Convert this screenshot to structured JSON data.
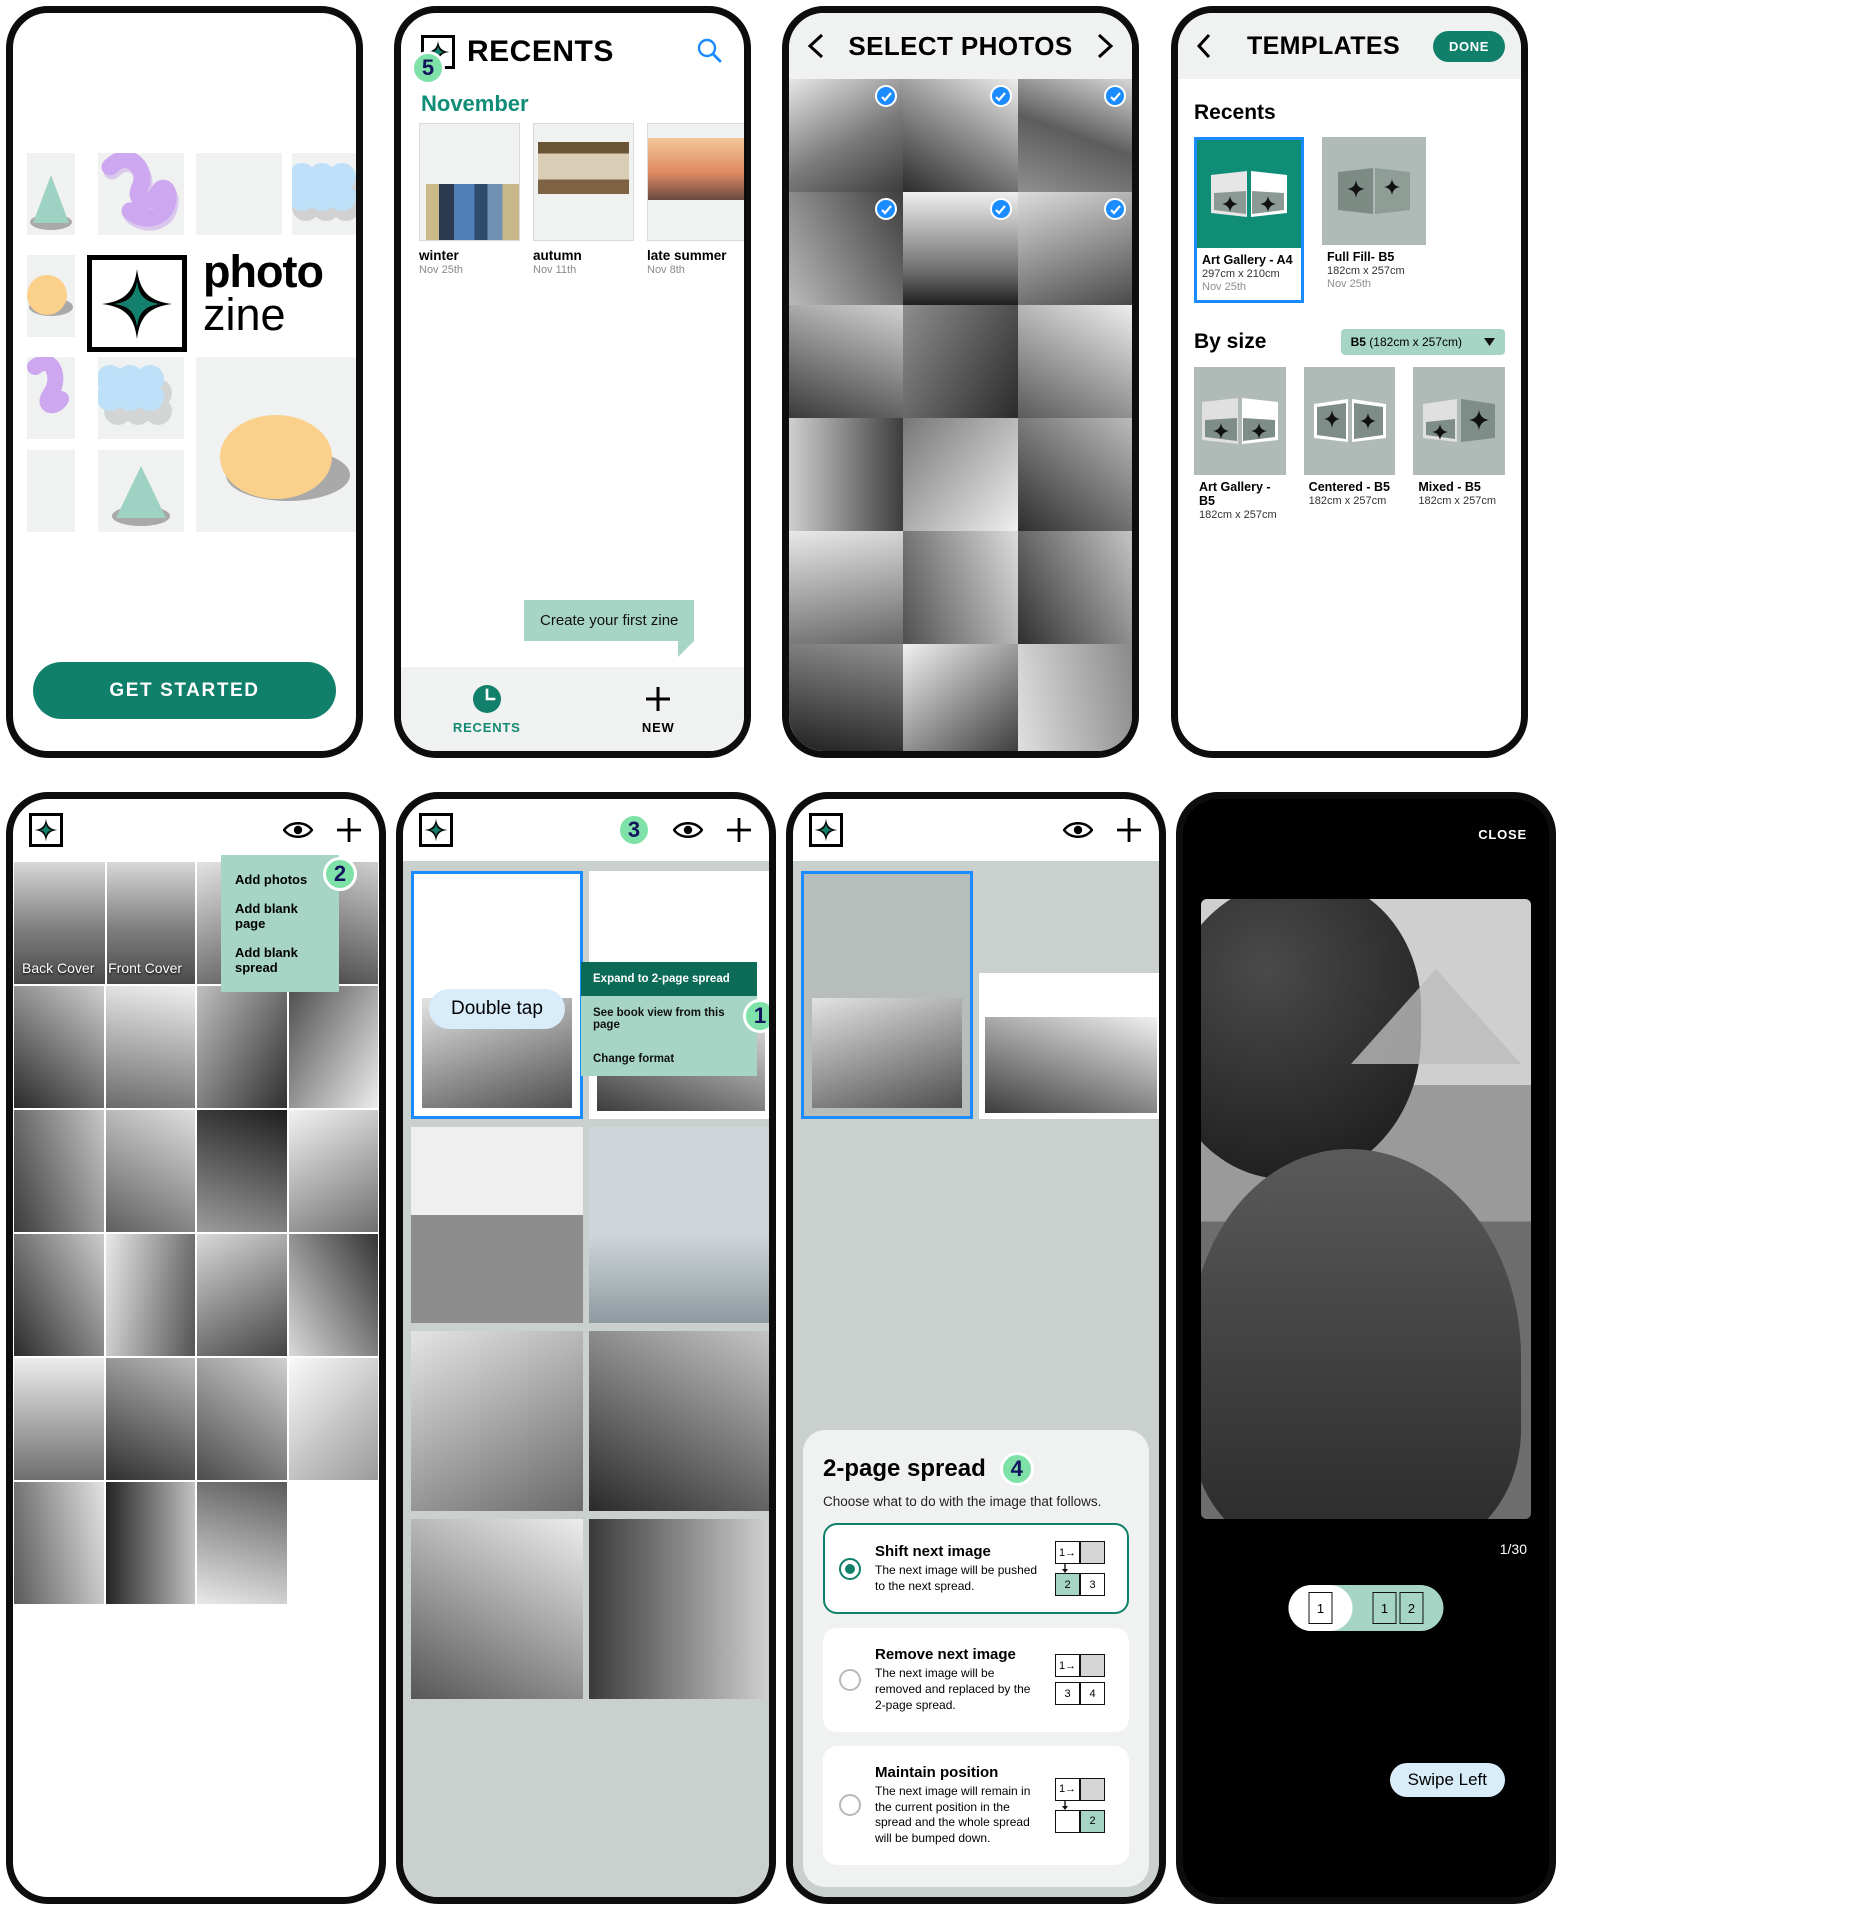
{
  "brand": {
    "accent": "#10806b",
    "mint": "#a6d5c6",
    "badge_green": "#7ee2a8",
    "blue": "#1a8cff"
  },
  "splash": {
    "logo_line1": "photo",
    "logo_line2": "zine",
    "logo_icon": "sparkle-icon",
    "cta_label": "GET STARTED"
  },
  "recents": {
    "badge": "5",
    "title": "RECENTS",
    "logo_icon": "sparkle-icon",
    "search_icon": "search-icon",
    "month": "November",
    "zines": [
      {
        "name": "winter",
        "date": "Nov 25th"
      },
      {
        "name": "autumn",
        "date": "Nov 11th"
      },
      {
        "name": "late summer",
        "date": "Nov 8th"
      }
    ],
    "tooltip": "Create your first zine",
    "tabs": [
      {
        "label": "RECENTS",
        "icon": "clock-icon",
        "active": true
      },
      {
        "label": "NEW",
        "icon": "plus-icon",
        "active": false
      }
    ]
  },
  "select_photos": {
    "title": "SELECT PHOTOS",
    "back_icon": "chevron-left-icon",
    "next_icon": "chevron-right-icon",
    "check_icon": "check-circle-icon",
    "selected_indices": [
      0,
      1,
      2,
      3,
      4,
      5
    ]
  },
  "templates": {
    "title": "TEMPLATES",
    "back_icon": "chevron-left-icon",
    "done_label": "DONE",
    "recents_heading": "Recents",
    "recents": [
      {
        "name": "Art Gallery - A4",
        "size": "297cm x 210cm",
        "date": "Nov 25th",
        "selected": true,
        "style": "art-gallery"
      },
      {
        "name": "Full Fill- B5",
        "size": "182cm x 257cm",
        "date": "Nov 25th",
        "selected": false,
        "style": "full-fill"
      }
    ],
    "bysize_heading": "By size",
    "size_filter": {
      "value_bold": "B5",
      "value_rest": "(182cm x 257cm)",
      "icon": "chevron-down-icon"
    },
    "bysize": [
      {
        "name": "Art Gallery - B5",
        "size": "182cm x 257cm",
        "style": "art-gallery"
      },
      {
        "name": "Centered - B5",
        "size": "182cm x 257cm",
        "style": "centered"
      },
      {
        "name": "Mixed - B5",
        "size": "182cm x 257cm",
        "style": "mixed"
      }
    ]
  },
  "editor_grid": {
    "logo_icon": "sparkle-icon",
    "preview_icon": "eye-icon",
    "add_icon": "plus-icon",
    "badge": "2",
    "menu": [
      "Add photos",
      "Add blank page",
      "Add blank spread"
    ],
    "back_cover_label": "Back Cover",
    "front_cover_label": "Front Cover"
  },
  "editor_spread": {
    "logo_icon": "sparkle-icon",
    "preview_icon": "eye-icon",
    "add_icon": "plus-icon",
    "badge": "3",
    "hint": "Double tap",
    "menu": [
      {
        "label": "Expand to 2-page spread",
        "highlighted": true
      },
      {
        "label": "See book view from this page",
        "highlighted": false
      },
      {
        "label": "Change format",
        "highlighted": false
      }
    ],
    "menu_badge": "1"
  },
  "spread_sheet": {
    "logo_icon": "sparkle-icon",
    "preview_icon": "eye-icon",
    "add_icon": "plus-icon",
    "title": "2-page spread",
    "badge": "4",
    "subtitle": "Choose what to do with the image that follows.",
    "options": [
      {
        "name": "Shift next image",
        "desc": "The next image will be pushed to the next spread.",
        "selected": true,
        "diagram": {
          "top": [
            "1→",
            ""
          ],
          "arrow": true,
          "bottom": [
            "2",
            "3"
          ],
          "bottom_green": [
            true,
            false
          ]
        }
      },
      {
        "name": "Remove next image",
        "desc": "The next image will be removed and replaced by the 2-page spread.",
        "selected": false,
        "diagram": {
          "top": [
            "1→",
            ""
          ],
          "arrow": false,
          "bottom": [
            "3",
            "4"
          ],
          "bottom_green": [
            false,
            false
          ]
        }
      },
      {
        "name": "Maintain position",
        "desc": "The next image will remain in the current position in the spread and the whole spread will be bumped down.",
        "selected": false,
        "diagram": {
          "top": [
            "1→",
            ""
          ],
          "arrow": true,
          "bottom": [
            "",
            "2"
          ],
          "bottom_green": [
            false,
            true
          ]
        }
      }
    ]
  },
  "viewer": {
    "close_label": "CLOSE",
    "swipe_tip": "Swipe Left",
    "counter": "1/30",
    "toggle": {
      "single": "1",
      "spread_left": "1",
      "spread_right": "2",
      "active": "spread"
    }
  }
}
